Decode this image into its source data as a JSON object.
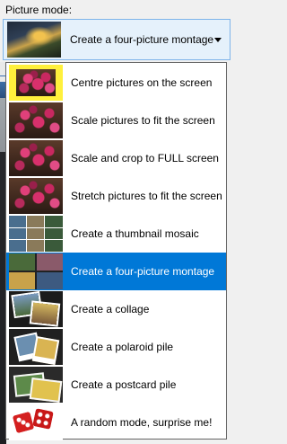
{
  "label": "Picture mode:",
  "combo": {
    "selected_text": "Create a four-picture montage",
    "icon": "road-thumbnail"
  },
  "options": [
    {
      "label": "Centre pictures on the screen",
      "icon": "centre-thumbnail"
    },
    {
      "label": "Scale pictures to fit the screen",
      "icon": "scale-thumbnail"
    },
    {
      "label": "Scale and crop to FULL screen",
      "icon": "crop-thumbnail"
    },
    {
      "label": "Stretch pictures to fit the screen",
      "icon": "stretch-thumbnail"
    },
    {
      "label": "Create a thumbnail mosaic",
      "icon": "mosaic-thumbnail"
    },
    {
      "label": "Create a four-picture montage",
      "icon": "montage-thumbnail",
      "selected": true
    },
    {
      "label": "Create a collage",
      "icon": "collage-thumbnail"
    },
    {
      "label": "Create a polaroid pile",
      "icon": "polaroid-thumbnail"
    },
    {
      "label": "Create a postcard pile",
      "icon": "postcard-thumbnail"
    },
    {
      "label": "A random mode, surprise me!",
      "icon": "dice-thumbnail"
    }
  ],
  "colors": {
    "selection": "#0078d7",
    "combo_background": "#e5f1fb",
    "combo_border": "#7eb4ea"
  }
}
